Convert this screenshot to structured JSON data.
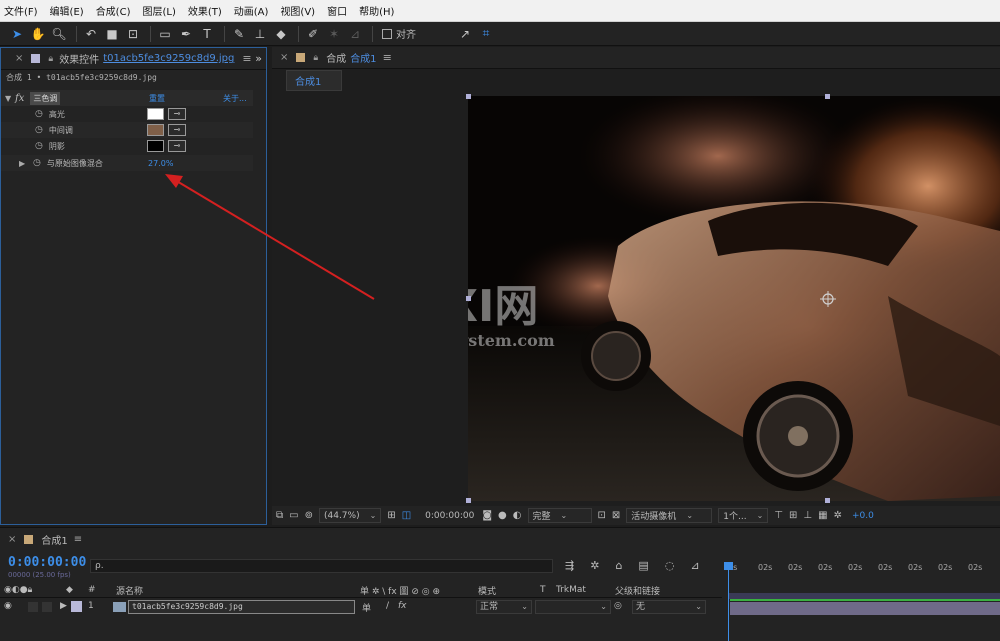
{
  "menu": [
    "文件(F)",
    "编辑(E)",
    "合成(C)",
    "图层(L)",
    "效果(T)",
    "动画(A)",
    "视图(V)",
    "窗口",
    "帮助(H)"
  ],
  "toolbar": {
    "snap_label": "对齐"
  },
  "effects_panel": {
    "title": "效果控件",
    "file": "t01acb5fe3c9259c8d9.jpg",
    "breadcrumb": "合成 1 • t01acb5fe3c9259c8d9.jpg",
    "fx_label": "fx",
    "effect_name": "三色调",
    "reset_label": "重置",
    "about_label": "关于...",
    "params": [
      {
        "name": "高光",
        "type": "color",
        "color": "#ffffff"
      },
      {
        "name": "中间调",
        "type": "color",
        "color": "#7f5f48"
      },
      {
        "name": "阴影",
        "type": "color",
        "color": "#000000"
      },
      {
        "name": "与原始图像混合",
        "type": "value",
        "value": "27.0%"
      }
    ]
  },
  "comp_panel": {
    "title": "合成",
    "name": "合成1",
    "tab": "合成1",
    "watermark_main": "GXI网",
    "watermark_sub": "system.com"
  },
  "comp_bar": {
    "zoom": "(44.7%)",
    "time": "0:00:00:00",
    "resolution": "完整",
    "camera": "活动摄像机",
    "views": "1个...",
    "exposure": "+0.0"
  },
  "timeline": {
    "tab": "合成1",
    "timecode": "0:00:00:00",
    "fps": "00000 (25.00 fps)",
    "search_placeholder": "ρ.",
    "columns": {
      "source_name": "源名称",
      "switches": "单 ✲ \\ fx 圖 ⊘ ◎ ⊕",
      "mode": "模式",
      "t": "T",
      "trkmat": "TrkMat",
      "parent": "父级和链接"
    },
    "ruler_labels": [
      "0s",
      "02s",
      "02s",
      "02s",
      "02s",
      "02s",
      "02s",
      "02s",
      "02s"
    ],
    "layers": [
      {
        "index": "1",
        "name": "t01acb5fe3c9259c8d9.jpg",
        "mode": "正常",
        "parent": "无"
      }
    ]
  },
  "colors": {
    "accent": "#3d8ee8",
    "annotation_arrow": "#d42020",
    "panel_bg": "#232323",
    "menubar_bg": "#f1f1f1"
  }
}
